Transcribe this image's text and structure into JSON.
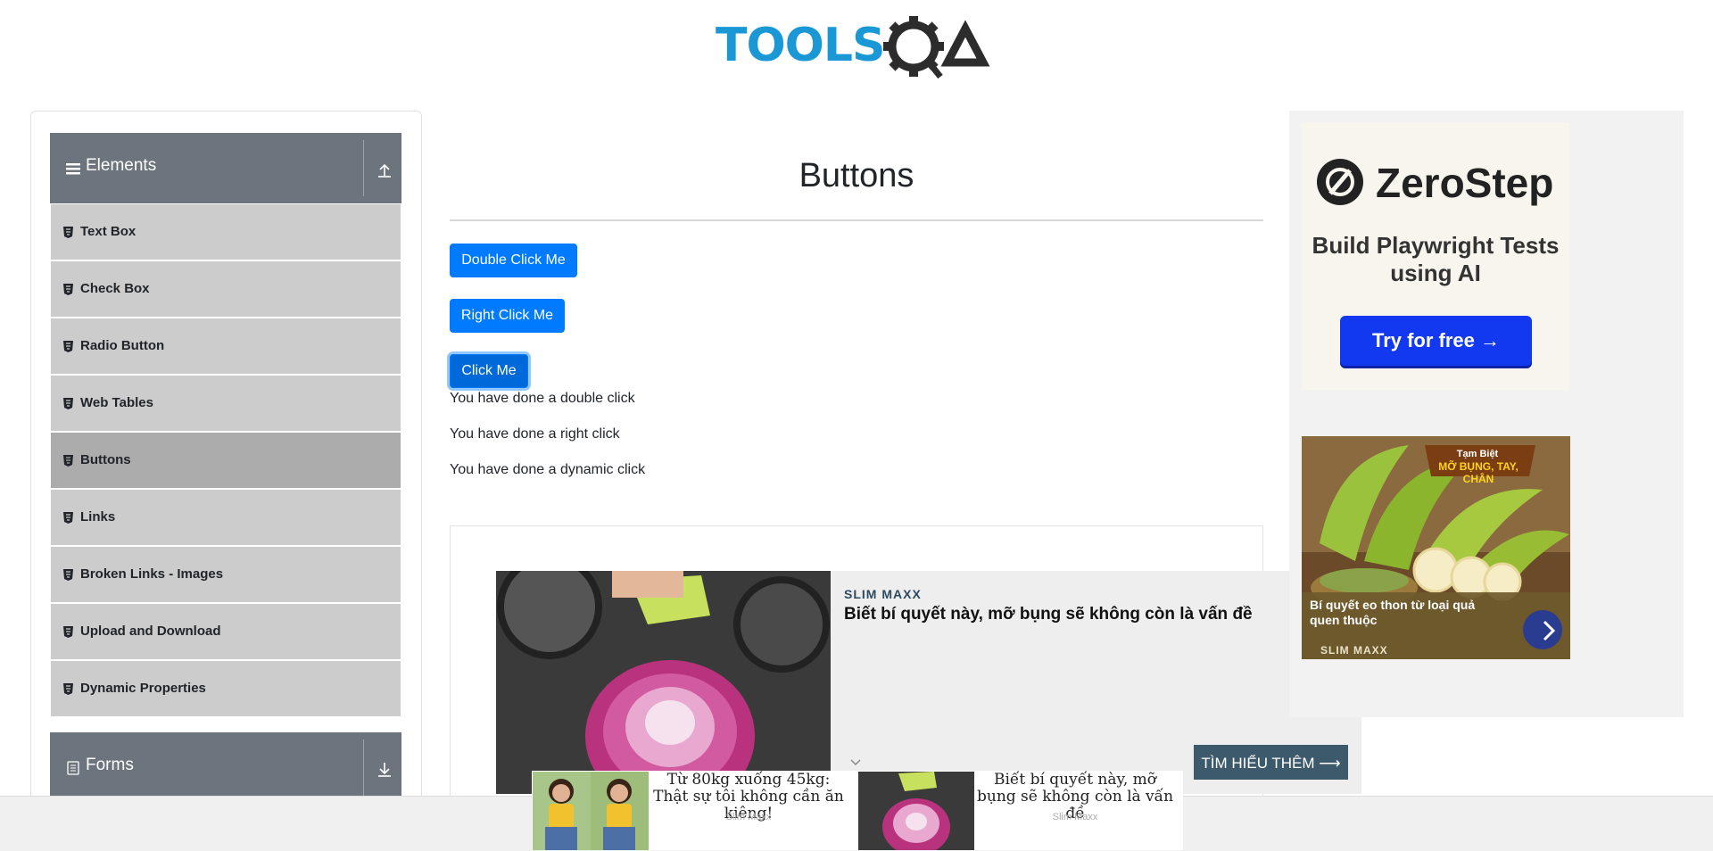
{
  "header": {
    "logo_text_left": "TOOLS",
    "logo_text_right": "QA"
  },
  "sidebar": {
    "group_elements": "Elements",
    "items": [
      {
        "label": "Text Box"
      },
      {
        "label": "Check Box"
      },
      {
        "label": "Radio Button"
      },
      {
        "label": "Web Tables"
      },
      {
        "label": "Buttons",
        "active": true
      },
      {
        "label": "Links"
      },
      {
        "label": "Broken Links - Images"
      },
      {
        "label": "Upload and Download"
      },
      {
        "label": "Dynamic Properties"
      }
    ],
    "group_forms": "Forms"
  },
  "main": {
    "title": "Buttons",
    "buttons": {
      "double_click": "Double Click Me",
      "right_click": "Right Click Me",
      "click": "Click Me"
    },
    "messages": {
      "double": "You have done a double click",
      "right": "You have done a right click",
      "dynamic": "You have done a dynamic click"
    }
  },
  "ad_main": {
    "brand": "SLIM MAXX",
    "headline": "Biết bí quyết này, mỡ bụng sẽ không còn là vấn đề",
    "cta": "TÌM HIỂU THÊM ⟶"
  },
  "ad_right": {
    "zerostep_name": "ZeroStep",
    "zerostep_tagline": "Build Playwright Tests using AI",
    "zerostep_cta": "Try for free →",
    "banana_tag_line1": "Tạm Biệt",
    "banana_tag_line2": "MỠ BỤNG, TAY, CHÂN",
    "banana_text": "Bí quyết eo thon từ loại quả quen thuộc",
    "banana_brand": "SLIM MAXX"
  },
  "ad_sticky": {
    "left_title": "Từ 80kg xuống 45kg: Thật sự tôi không cần ăn kiêng!",
    "left_source": "Slim Maxx",
    "right_title": "Biết bí quyết này, mỡ bụng sẽ không còn là vấn đề",
    "right_source": "Slim Maxx"
  },
  "colors": {
    "primary_button": "#007bff",
    "sidebar_header": "#6c757d",
    "menu_item": "#cccccc",
    "menu_item_active": "#acacac",
    "logo_blue": "#1a97d5",
    "logo_dark": "#2c2c2c"
  }
}
